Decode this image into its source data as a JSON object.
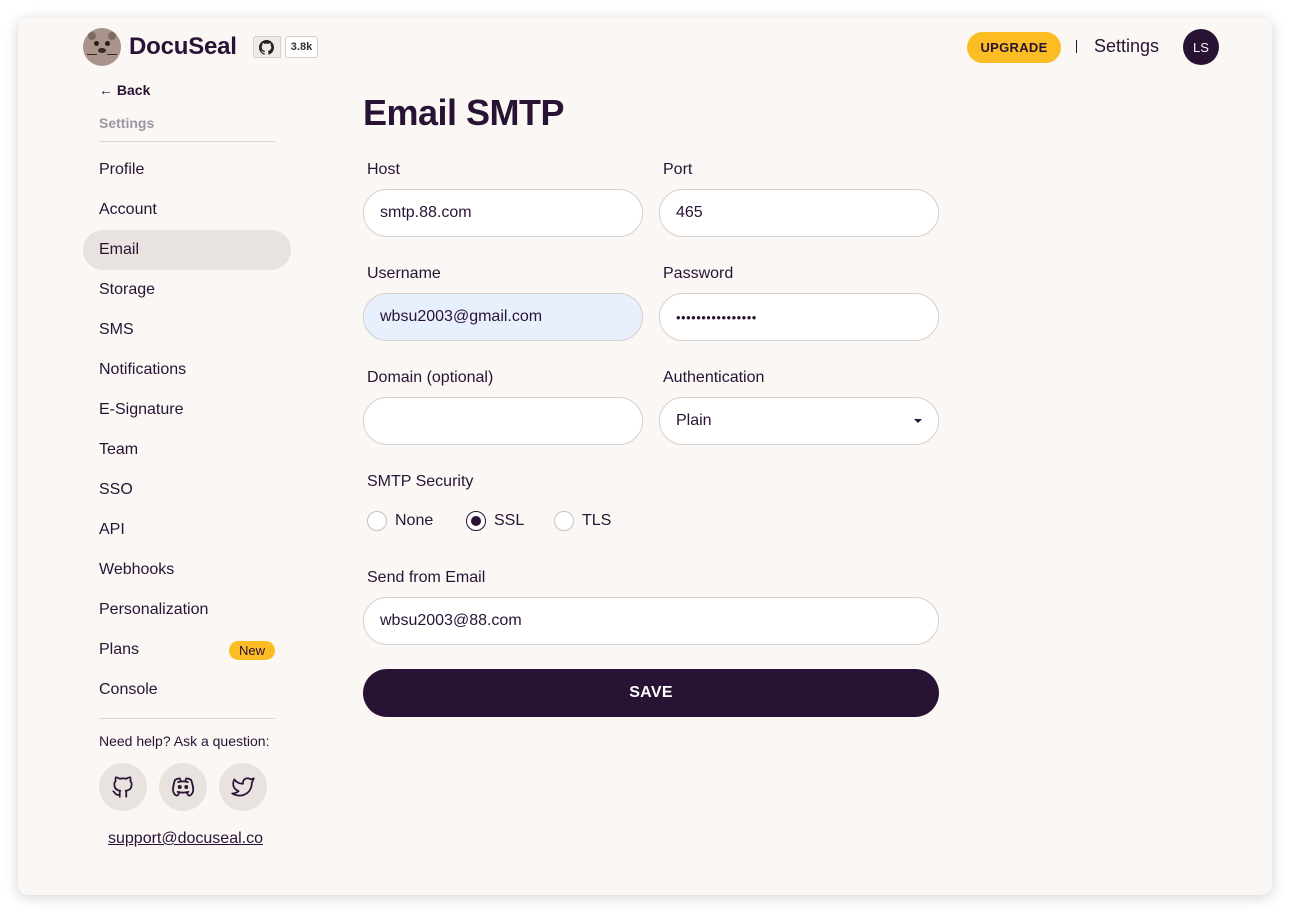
{
  "brand": {
    "name": "DocuSeal",
    "github_stars": "3.8k"
  },
  "nav": {
    "upgrade_label": "UPGRADE",
    "settings_label": "Settings",
    "avatar_initials": "LS"
  },
  "sidebar": {
    "back_label": "← Back",
    "heading": "Settings",
    "items": [
      {
        "label": "Profile"
      },
      {
        "label": "Account"
      },
      {
        "label": "Email",
        "active": true
      },
      {
        "label": "Storage"
      },
      {
        "label": "SMS"
      },
      {
        "label": "Notifications"
      },
      {
        "label": "E-Signature"
      },
      {
        "label": "Team"
      },
      {
        "label": "SSO"
      },
      {
        "label": "API"
      },
      {
        "label": "Webhooks"
      },
      {
        "label": "Personalization"
      },
      {
        "label": "Plans",
        "badge": "New"
      },
      {
        "label": "Console"
      }
    ],
    "help_text": "Need help? Ask a question:",
    "social_icons": [
      "github-icon",
      "discord-icon",
      "twitter-icon"
    ],
    "support_email": "support@docuseal.co"
  },
  "main": {
    "title": "Email SMTP",
    "host": {
      "label": "Host",
      "value": "smtp.88.com"
    },
    "port": {
      "label": "Port",
      "value": "465"
    },
    "username": {
      "label": "Username",
      "value": "wbsu2003@gmail.com"
    },
    "password": {
      "label": "Password",
      "value": "••••••••••••••••"
    },
    "domain": {
      "label": "Domain (optional)",
      "value": ""
    },
    "authentication": {
      "label": "Authentication",
      "value": "Plain"
    },
    "smtp_security": {
      "label": "SMTP Security",
      "options": [
        "None",
        "SSL",
        "TLS"
      ],
      "selected": "SSL"
    },
    "send_from": {
      "label": "Send from Email",
      "value": "wbsu2003@88.com"
    },
    "save_label": "SAVE"
  },
  "colors": {
    "primary": "#291334",
    "accent": "#fbbd23",
    "background": "#faf7f5"
  }
}
